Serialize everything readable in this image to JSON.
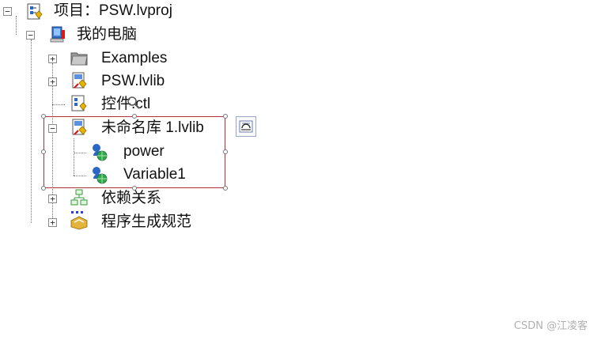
{
  "tree": {
    "project_label": "项目：PSW.lvproj",
    "computer_label": "我的电脑",
    "items": [
      {
        "label": "Examples"
      },
      {
        "label": "PSW.lvlib"
      },
      {
        "label": "控件.ctl"
      },
      {
        "label": "未命名库 1.lvlib"
      },
      {
        "label": "power"
      },
      {
        "label": "Variable1"
      },
      {
        "label": "依赖关系"
      },
      {
        "label": "程序生成规范"
      }
    ]
  },
  "watermark": "CSDN @江凌客",
  "colors": {
    "selection_border": "#b2323c",
    "folder_gray": "#8c8c8c",
    "vi_blue": "#2b67c6",
    "globe_green": "#2fa84a"
  },
  "icons": {
    "project": "project-icon",
    "computer": "computer-icon",
    "folder": "folder-icon",
    "library": "library-icon",
    "control": "control-icon",
    "shared_variable": "shared-variable-icon",
    "dependencies": "dependencies-icon",
    "build_specs": "build-specifications-icon"
  }
}
